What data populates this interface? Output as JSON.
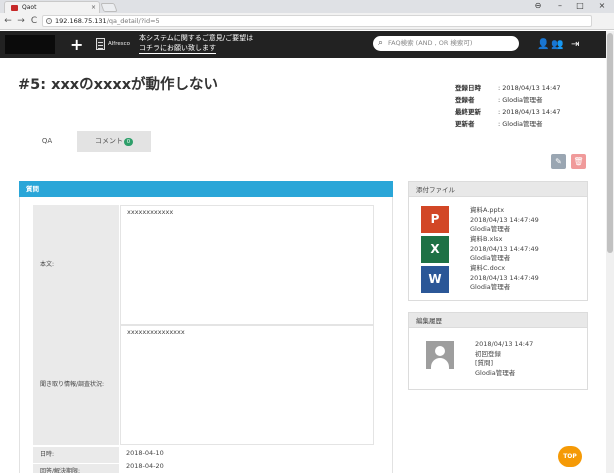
{
  "browser": {
    "tab_title": "Qaot",
    "tab_close": "×",
    "newtab_label": "",
    "url_host": "192.168.75.131",
    "url_path": "/qa_detail/?id=5",
    "back": "←",
    "forward": "→",
    "reload": "C",
    "info": "i",
    "win_account": "⊖",
    "win_min": "–",
    "win_max": "□",
    "win_close": "×"
  },
  "header": {
    "plus": "+",
    "alfresco": "Alfresco",
    "notice_line1": "本システムに関するご意見/ご要望は",
    "notice_line2": "コチラにお願い致します",
    "search_placeholder": "FAQ検索 (AND , OR 検索可)",
    "search_glyph": "⌕",
    "user_icon": "👤",
    "group_icon": "👥",
    "logout_icon": "⇥"
  },
  "page": {
    "title": "#5: xxxのxxxxが動作しない",
    "meta": [
      {
        "k": "登録日時",
        "v": ": 2018/04/13 14:47"
      },
      {
        "k": "登録者",
        "v": ": Glodia管理者"
      },
      {
        "k": "最終更新",
        "v": ": 2018/04/13 14:47"
      },
      {
        "k": "更新者",
        "v": ": Glodia管理者"
      }
    ],
    "tabs": {
      "qa": "QA",
      "comment": "コメント",
      "comment_count": "0"
    },
    "buttons": {
      "edit": "✎",
      "delete": "🗑"
    },
    "question": {
      "heading": "質問",
      "fields": [
        {
          "label": "本文:",
          "value": "xxxxxxxxxxxx"
        },
        {
          "label": "聞き取り情報/調査状況:",
          "value": "xxxxxxxxxxxxxxx"
        },
        {
          "label": "日時:",
          "value": "2018-04-10"
        },
        {
          "label": "回答/解決期限:",
          "value": "2018-04-20"
        }
      ]
    },
    "attachments": {
      "heading": "添付ファイル",
      "items": [
        {
          "icon": "P",
          "kind": "ppt",
          "name": "資料A.pptx",
          "date": "2018/04/13 14:47:49",
          "owner": "Glodia管理者"
        },
        {
          "icon": "X",
          "kind": "xls",
          "name": "資料B.xlsx",
          "date": "2018/04/13 14:47:49",
          "owner": "Glodia管理者"
        },
        {
          "icon": "W",
          "kind": "doc",
          "name": "資料C.docx",
          "date": "2018/04/13 14:47:49",
          "owner": "Glodia管理者"
        }
      ]
    },
    "history": {
      "heading": "編集履歴",
      "date": "2018/04/13 14:47",
      "action": "初回登録",
      "target": "[質問]",
      "user": "Glodia管理者"
    },
    "top_button": "TOP"
  }
}
